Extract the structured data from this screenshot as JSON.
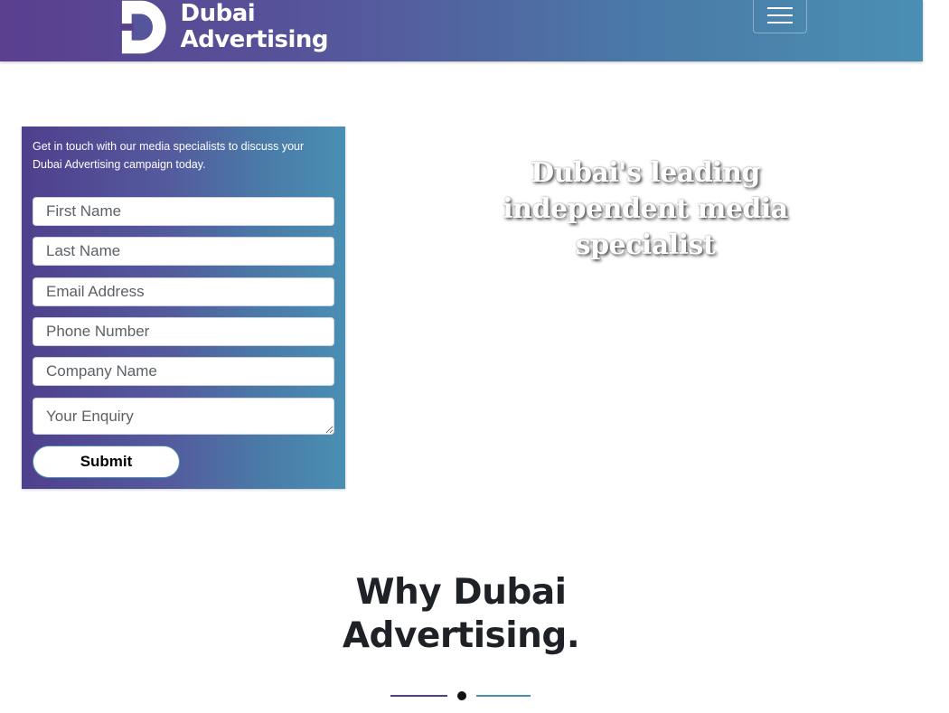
{
  "brand": {
    "logo_line1": "Dubai",
    "logo_line2": "Advertising",
    "logo_mark_icon": "letter-d-logo-icon"
  },
  "nav": {
    "menu_icon": "hamburger-menu-icon"
  },
  "form": {
    "intro": "Get in touch with our media specialists to discuss your Dubai Advertising campaign today.",
    "fields": [
      {
        "placeholder": "First Name",
        "value": ""
      },
      {
        "placeholder": "Last Name",
        "value": ""
      },
      {
        "placeholder": "Email Address",
        "value": ""
      },
      {
        "placeholder": "Phone Number",
        "value": ""
      },
      {
        "placeholder": "Company Name",
        "value": ""
      },
      {
        "placeholder": "Your Enquiry",
        "value": ""
      }
    ],
    "submit_label": "Submit"
  },
  "hero": {
    "heading": "Dubai's leading independent media specialist"
  },
  "why": {
    "title_line1": "Why Dubai",
    "title_line2": "Advertising."
  },
  "colors": {
    "gradient_start": "#5a3f8f",
    "gradient_end": "#4a8fb4",
    "title_text": "#1e2126"
  }
}
